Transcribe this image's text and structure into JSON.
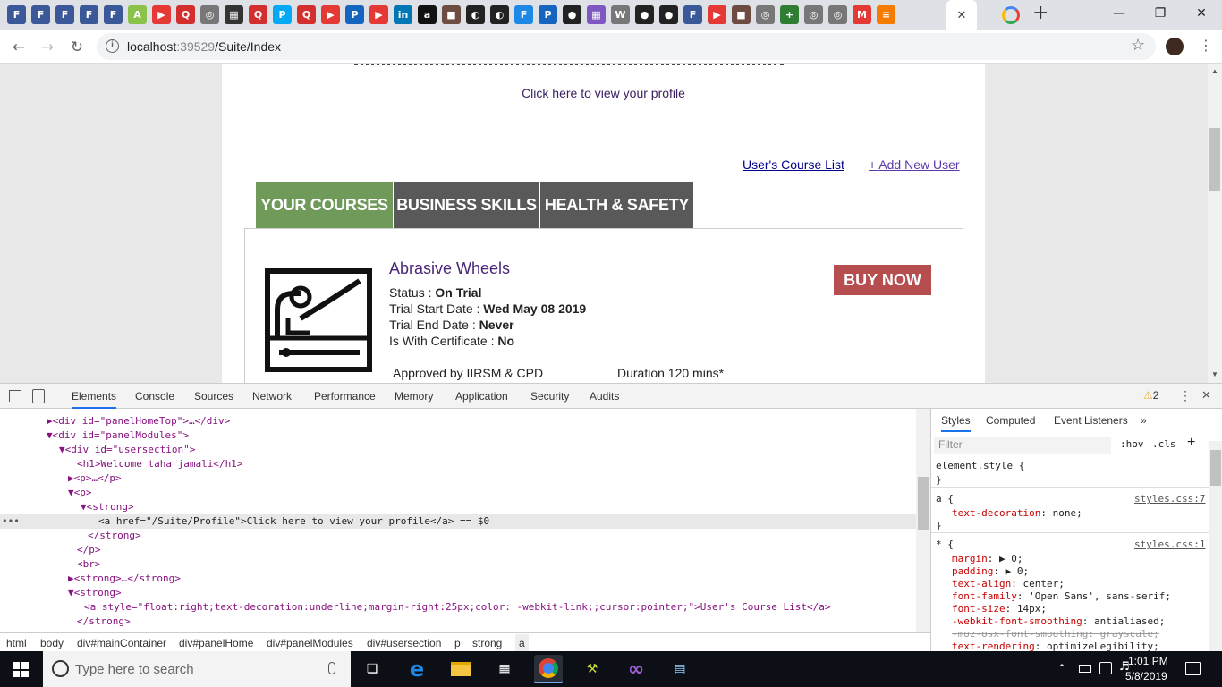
{
  "browser": {
    "new_tab_symbol": "+",
    "close_tab_symbol": "✕",
    "url_host": "localhost",
    "url_port": ":39529",
    "url_path": "/Suite/Index",
    "bookmark_letters": [
      "F",
      "F",
      "F",
      "F",
      "F",
      "A",
      "▶",
      "Q",
      "◎",
      "▦",
      "Q",
      "P",
      "Q",
      "▶",
      "P",
      "▶",
      "in",
      "a",
      "■",
      "◐",
      "◐",
      "F",
      "P",
      "●",
      "▦",
      "W",
      "●",
      "●",
      "F",
      "▶",
      "■",
      "◎",
      "+",
      "◎",
      "◎",
      "M",
      "≡"
    ],
    "bookmark_colors": [
      "#3b5998",
      "#3b5998",
      "#3b5998",
      "#3b5998",
      "#3b5998",
      "#8bc34a",
      "#e53935",
      "#d32f2f",
      "#777777",
      "#333333",
      "#d32f2f",
      "#03a9f4",
      "#d32f2f",
      "#e53935",
      "#1565c0",
      "#e53935",
      "#0077b5",
      "#111111",
      "#6d4c41",
      "#222222",
      "#222222",
      "#1e88e5",
      "#1565c0",
      "#222222",
      "#7e57c2",
      "#777777",
      "#222222",
      "#222222",
      "#3b5998",
      "#e53935",
      "#6d4c41",
      "#777777",
      "#2e7d32",
      "#777777",
      "#777777",
      "#e53935",
      "#f57c00"
    ]
  },
  "page": {
    "profile_link": "Click here to view your profile",
    "users_course_list": "User's Course List",
    "add_new_user": "+ Add New User",
    "tabs": [
      "YOUR COURSES",
      "BUSINESS SKILLS",
      "HEALTH & SAFETY"
    ],
    "tab_colors": [
      "#6f9a5a",
      "#595959",
      "#595959"
    ],
    "course": {
      "title": "Abrasive Wheels",
      "status_label": "Status : ",
      "status_value": "On Trial",
      "start_label": "Trial Start Date : ",
      "start_value": "Wed May 08 2019",
      "end_label": "Trial End Date : ",
      "end_value": "Never",
      "cert_label": "Is With Certificate : ",
      "cert_value": "No",
      "approved": "Approved by IIRSM & CPD",
      "duration": "Duration 120 mins*",
      "buy_label": "BUY NOW"
    }
  },
  "devtools": {
    "tabs": [
      "Elements",
      "Console",
      "Sources",
      "Network",
      "Performance",
      "Memory",
      "Application",
      "Security",
      "Audits"
    ],
    "warning_count": "2",
    "dom_lines": [
      {
        "t": "▶<div id=\"panelHomeTop\">…</div>"
      },
      {
        "t": "▼<div id=\"panelModules\">"
      },
      {
        "t": "▼<div id=\"usersection\">"
      },
      {
        "t": "<h1>Welcome taha jamali</h1>"
      },
      {
        "t": "▶<p>…</p>"
      },
      {
        "t": "▼<p>"
      },
      {
        "t": "▼<strong>"
      },
      {
        "t": "<a href=\"/Suite/Profile\">Click here to view your profile</a> == $0"
      },
      {
        "t": "</strong>"
      },
      {
        "t": "</p>"
      },
      {
        "t": "<br>"
      },
      {
        "t": "▶<strong>…</strong>"
      },
      {
        "t": "▼<strong>"
      },
      {
        "t": "<a style=\"float:right;text-decoration:underline;margin-right:25px;color: -webkit-link;;cursor:pointer;\">User's Course List</a>"
      },
      {
        "t": "</strong>"
      }
    ],
    "breadcrumbs": [
      "html",
      "body",
      "div#mainContainer",
      "div#panelHome",
      "div#panelModules",
      "div#usersection",
      "p",
      "strong",
      "a"
    ],
    "styles_tabs": [
      "Styles",
      "Computed",
      "Event Listeners",
      "»"
    ],
    "filter_placeholder": "Filter",
    "hov": ":hov",
    "cls": ".cls",
    "element_style": "element.style {",
    "rule1_selector": "a {",
    "rule1_source": "styles.css:7",
    "rule1_props": [
      [
        "text-decoration",
        "none;"
      ]
    ],
    "rule2_selector": "* {",
    "rule2_source": "styles.css:1",
    "rule2_props": [
      [
        "margin",
        "▶ 0;"
      ],
      [
        "padding",
        "▶ 0;"
      ],
      [
        "text-align",
        "center;"
      ],
      [
        "font-family",
        "'Open Sans', sans-serif;"
      ],
      [
        "font-size",
        "14px;"
      ],
      [
        "-webkit-font-smoothing",
        "antialiased;"
      ],
      [
        "-moz-osx-font-smoothing",
        "grayscale;"
      ],
      [
        "text-rendering",
        "optimizeLegibility;"
      ]
    ]
  },
  "taskbar": {
    "search_placeholder": "Type here to search",
    "time": "1:01 PM",
    "date": "5/8/2019"
  }
}
